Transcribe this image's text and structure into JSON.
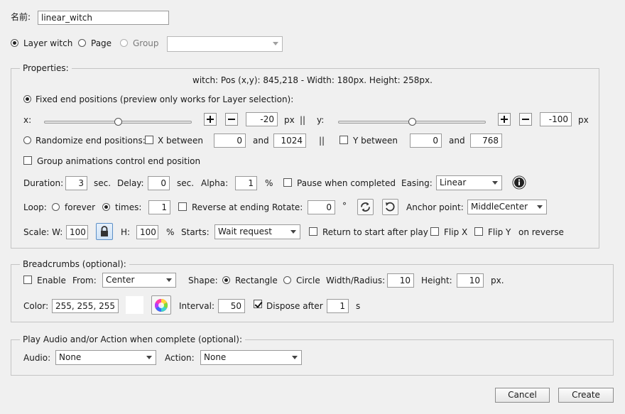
{
  "name": {
    "label": "名前:",
    "value": "linear_witch"
  },
  "target": {
    "options": [
      {
        "label": "Layer witch",
        "selected": true,
        "enabled": true
      },
      {
        "label": "Page",
        "selected": false,
        "enabled": true
      },
      {
        "label": "Group",
        "selected": false,
        "enabled": false
      }
    ],
    "group_select_value": ""
  },
  "properties": {
    "legend": "Properties:",
    "info": "witch: Pos (x,y): 845,218 - Width: 180px. Height: 258px.",
    "fixed_label": "Fixed end positions (preview only works for Layer selection):",
    "fixed_selected": true,
    "x_label": "x:",
    "x_value": "-20",
    "x_slider": 0.5,
    "y_label": "y:",
    "y_value": "-100",
    "y_slider": 0.5,
    "px": "px",
    "sep": "||",
    "randomize_label": "Randomize end positions:",
    "x_between_label": "X between",
    "x_between_checked": false,
    "x_min": "0",
    "and": "and",
    "x_max": "1024",
    "y_between_label": "Y between",
    "y_between_checked": false,
    "y_min": "0",
    "y_max": "768",
    "group_anim_label": "Group animations control end position",
    "group_anim_checked": false,
    "duration_label": "Duration:",
    "duration": "3",
    "sec": "sec.",
    "delay_label": "Delay:",
    "delay": "0",
    "alpha_label": "Alpha:",
    "alpha": "1",
    "percent": "%",
    "pause_label": "Pause when completed",
    "pause_checked": false,
    "easing_label": "Easing:",
    "easing": "Linear",
    "loop_label": "Loop:",
    "forever_label": "forever",
    "times_label": "times:",
    "times": "1",
    "reverse_label": "Reverse at ending",
    "reverse_checked": false,
    "rotate_label": "Rotate:",
    "rotate": "0",
    "degree": "°",
    "anchor_label": "Anchor point:",
    "anchor": "MiddleCenter",
    "scale_label": "Scale: W:",
    "scale_w": "100",
    "scale_h_label": "H:",
    "scale_h": "100",
    "starts_label": "Starts:",
    "starts": "Wait request",
    "return_label": "Return to start after play",
    "return_checked": false,
    "flipx_label": "Flip X",
    "flipy_label": "Flip Y",
    "on_reverse": "on reverse"
  },
  "breadcrumbs": {
    "legend": "Breadcrumbs (optional):",
    "enable_label": "Enable",
    "enable_checked": false,
    "from_label": "From:",
    "from": "Center",
    "shape_label": "Shape:",
    "rectangle_label": "Rectangle",
    "circle_label": "Circle",
    "width_label": "Width/Radius:",
    "width": "10",
    "height_label": "Height:",
    "height": "10",
    "px": "px.",
    "color_label": "Color:",
    "color": "255, 255, 255",
    "swatch_color": "#ffffff",
    "interval_label": "Interval:",
    "interval": "50",
    "dispose_label": "Dispose after",
    "dispose_checked": true,
    "dispose": "1",
    "s": "s"
  },
  "audio_action": {
    "legend": "Play Audio and/or Action when complete (optional):",
    "audio_label": "Audio:",
    "audio": "None",
    "action_label": "Action:",
    "action": "None"
  },
  "buttons": {
    "cancel": "Cancel",
    "create": "Create"
  }
}
